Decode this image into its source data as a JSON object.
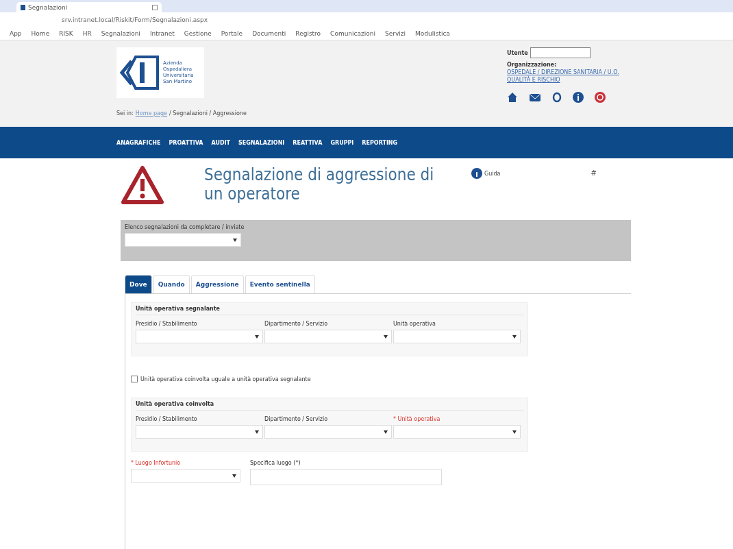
{
  "browser": {
    "tab_title": "Segnalazioni",
    "url": "srv.intranet.local/Riskit/Form/Segnalazioni.aspx",
    "bookmarks": [
      "App",
      "Home",
      "RISK",
      "HR",
      "Segnalazioni",
      "Intranet",
      "Gestione",
      "Portale",
      "Documenti",
      "Registro",
      "Comunicazioni",
      "Servizi",
      "Modulistica"
    ]
  },
  "header": {
    "logo_lines": [
      "Azienda",
      "Ospedaliera",
      "Universitaria",
      "San Martino"
    ],
    "user_label": "Utente",
    "org_label": "Organizzazione:",
    "org_link": "OSPEDALE / DIREZIONE SANITARIA / U.O. QUALITÀ E RISCHIO",
    "breadcrumb": [
      {
        "label": "Sei in:",
        "kind": "text"
      },
      {
        "label": "Home page",
        "kind": "link"
      },
      {
        "label": "/ Segnalazioni / Aggressione",
        "kind": "text"
      }
    ]
  },
  "nav": [
    "ANAGRAFICHE",
    "PROATTIVA",
    "AUDIT",
    "SEGNALAZIONI",
    "REATTIVA",
    "GRUPPI",
    "REPORTING"
  ],
  "page": {
    "title": "Segnalazione di aggressione di un operatore",
    "help": "Guida",
    "pin": "#"
  },
  "select_box": {
    "label": "Elenco segnalazioni da completare / inviate"
  },
  "tabs": [
    {
      "label": "Dove",
      "selected": true
    },
    {
      "label": "Quando",
      "selected": false
    },
    {
      "label": "Aggressione",
      "selected": false
    },
    {
      "label": "Evento sentinella",
      "selected": false
    }
  ],
  "sections": [
    {
      "legend": "Unità operativa segnalante",
      "fields": [
        {
          "label": "Presidio / Stabilimento",
          "required": false
        },
        {
          "label": "Dipartimento / Servizio",
          "required": false
        },
        {
          "label": "Unità operativa",
          "required": false
        }
      ]
    },
    {
      "legend": "Unità operativa coinvolta",
      "fields": [
        {
          "label": "Presidio / Stabilimento",
          "required": false
        },
        {
          "label": "Dipartimento / Servizio",
          "required": false
        },
        {
          "label": "* Unità operativa",
          "required": true
        }
      ]
    }
  ],
  "same_unit": {
    "label": "Unità operativa coinvolta uguale a unità operativa segnalante",
    "checked": false
  },
  "place": {
    "label": "* Luogo Infortunio",
    "required": true
  },
  "place_detail": {
    "label": "Specifica luogo (*)"
  }
}
